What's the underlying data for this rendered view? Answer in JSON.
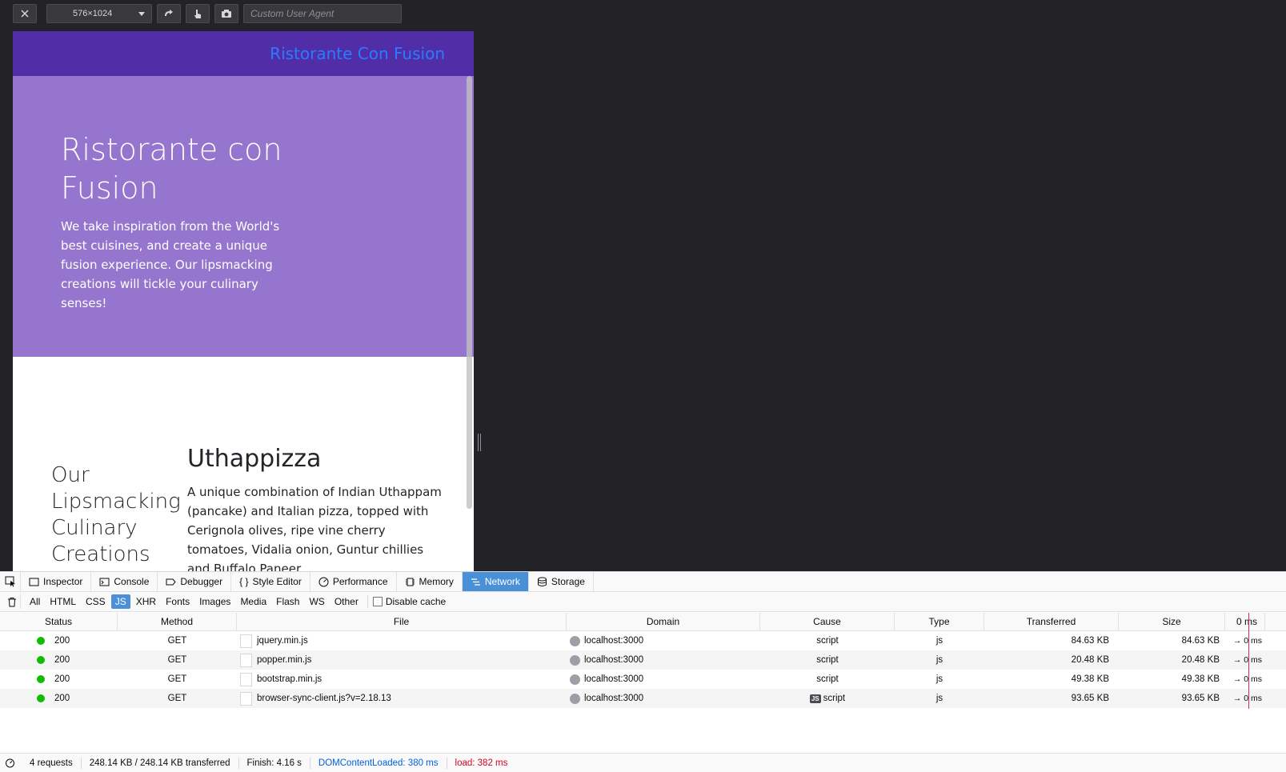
{
  "rdm": {
    "device_size": "576×1024",
    "ua_placeholder": "Custom User Agent"
  },
  "site": {
    "brand": "Ristorante Con Fusion",
    "hero_title": "Ristorante con Fusion",
    "hero_text": "We take inspiration from the World's best cuisines, and create a unique fusion experience. Our lipsmacking creations will tickle your culinary senses!",
    "section_title": "Our Lipsmacking Culinary Creations",
    "dish_name": "Uthappizza",
    "dish_desc": "A unique combination of Indian Uthappam (pancake) and Italian pizza, topped with Cerignola olives, ripe vine cherry tomatoes, Vidalia onion, Guntur chillies and Buffalo Paneer.",
    "colors": {
      "navbar": "#512da8",
      "jumbotron": "#9575cd",
      "brand": "#2a7cff"
    }
  },
  "devtools": {
    "tabs": [
      {
        "label": "Inspector",
        "icon": "inspector-icon"
      },
      {
        "label": "Console",
        "icon": "console-icon"
      },
      {
        "label": "Debugger",
        "icon": "debugger-icon"
      },
      {
        "label": "Style Editor",
        "icon": "style-editor-icon"
      },
      {
        "label": "Performance",
        "icon": "performance-icon"
      },
      {
        "label": "Memory",
        "icon": "memory-icon"
      },
      {
        "label": "Network",
        "icon": "network-icon"
      },
      {
        "label": "Storage",
        "icon": "storage-icon"
      }
    ],
    "active_tab": "Network",
    "filters": [
      "All",
      "HTML",
      "CSS",
      "JS",
      "XHR",
      "Fonts",
      "Images",
      "Media",
      "Flash",
      "WS",
      "Other"
    ],
    "active_filter": "JS",
    "disable_cache": "Disable cache",
    "columns": {
      "status": "Status",
      "method": "Method",
      "file": "File",
      "domain": "Domain",
      "cause": "Cause",
      "type": "Type",
      "transferred": "Transferred",
      "size": "Size",
      "waterfall": "0 ms"
    },
    "rows": [
      {
        "status": "200",
        "method": "GET",
        "file": "jquery.min.js",
        "domain": "localhost:3000",
        "cause": "script",
        "js_badge": "",
        "type": "js",
        "transferred": "84.63 KB",
        "size": "84.63 KB",
        "timing": "→ 0 ms"
      },
      {
        "status": "200",
        "method": "GET",
        "file": "popper.min.js",
        "domain": "localhost:3000",
        "cause": "script",
        "js_badge": "",
        "type": "js",
        "transferred": "20.48 KB",
        "size": "20.48 KB",
        "timing": "→ 0 ms"
      },
      {
        "status": "200",
        "method": "GET",
        "file": "bootstrap.min.js",
        "domain": "localhost:3000",
        "cause": "script",
        "js_badge": "",
        "type": "js",
        "transferred": "49.38 KB",
        "size": "49.38 KB",
        "timing": "→ 0 ms"
      },
      {
        "status": "200",
        "method": "GET",
        "file": "browser-sync-client.js?v=2.18.13",
        "domain": "localhost:3000",
        "cause": "script",
        "js_badge": "JS",
        "type": "js",
        "transferred": "93.65 KB",
        "size": "93.65 KB",
        "timing": "→ 0 ms"
      }
    ],
    "footer": {
      "requests": "4 requests",
      "transferred": "248.14 KB / 248.14 KB transferred",
      "finish": "Finish: 4.16 s",
      "dcl": "DOMContentLoaded: 380 ms",
      "load": "load: 382 ms"
    }
  }
}
